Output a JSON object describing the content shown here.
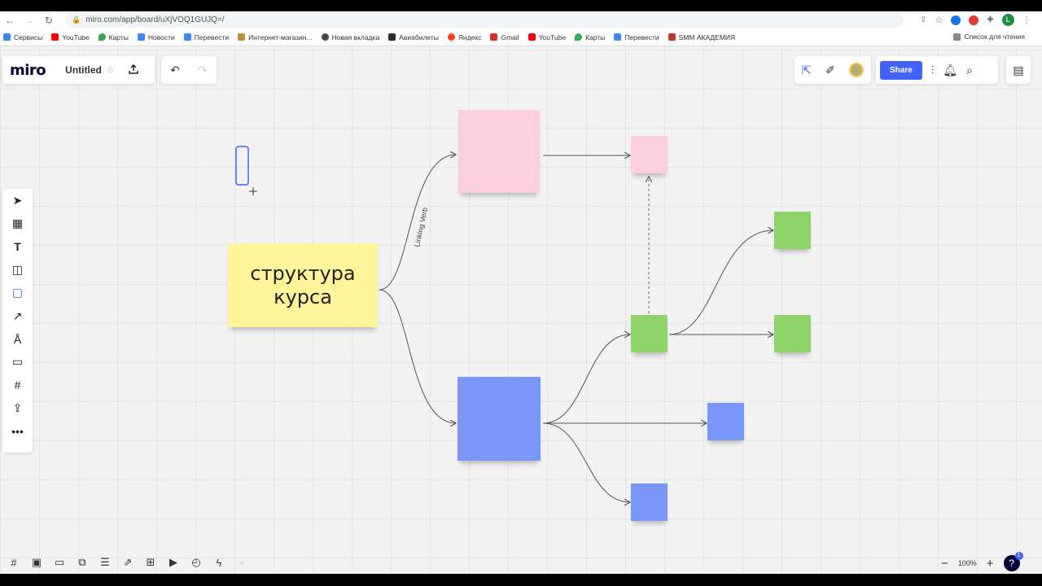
{
  "browser": {
    "url": "miro.com/app/board/uXjVOQ1GUJQ=/",
    "bookmarks": [
      {
        "label": "Сервисы",
        "color": "#4285f4"
      },
      {
        "label": "YouTube",
        "color": "#ff0000"
      },
      {
        "label": "Карты",
        "color": "#34a853"
      },
      {
        "label": "Новости",
        "color": "#4285f4"
      },
      {
        "label": "Перевести",
        "color": "#4285f4"
      },
      {
        "label": "Интернет-магазин...",
        "color": "#c28a3a"
      },
      {
        "label": "Новая вкладка",
        "color": "#444444"
      },
      {
        "label": "Авиабилеты",
        "color": "#2b2b2b"
      },
      {
        "label": "Яндекс",
        "color": "#fc3f1d"
      },
      {
        "label": "Gmail",
        "color": "#d93025"
      },
      {
        "label": "YouTube",
        "color": "#ff0000"
      },
      {
        "label": "Карты",
        "color": "#34a853"
      },
      {
        "label": "Перевести",
        "color": "#4285f4"
      },
      {
        "label": "SMM АКАДЕМИЯ",
        "color": "#c0392b"
      }
    ],
    "reading_list": "Список для чтения",
    "profile_initial": "L"
  },
  "app": {
    "logo": "miro",
    "board_title": "Untitled",
    "share_label": "Share",
    "zoom": "100%",
    "help_badge": "1"
  },
  "board": {
    "main_note": "структура курса",
    "connector_label": "Linking Verb"
  },
  "colors": {
    "yellow": "#fef59a",
    "pink": "#fccfdf",
    "green": "#8fd36b",
    "blue": "#7a96f9",
    "accent": "#4262ff"
  }
}
